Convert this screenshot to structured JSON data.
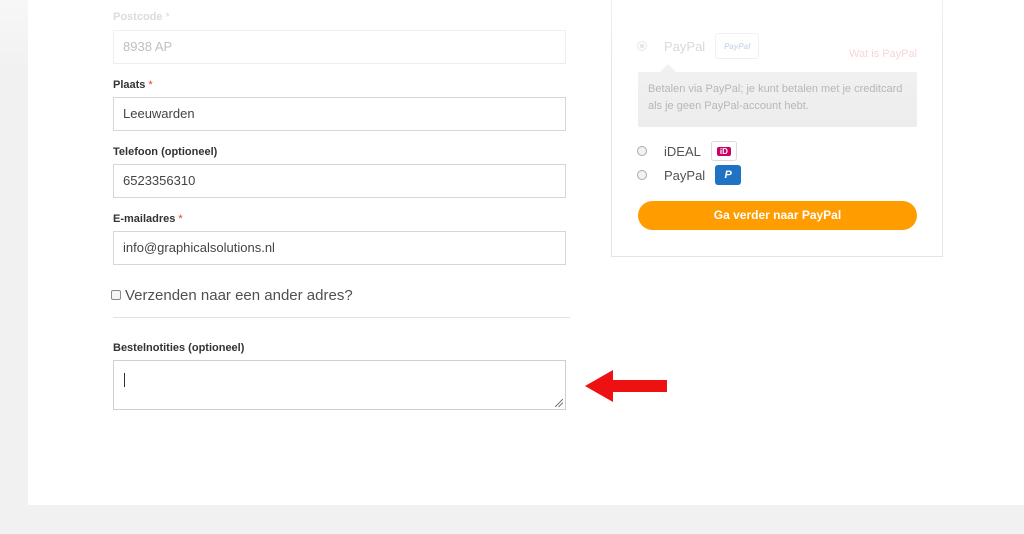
{
  "form": {
    "postcode": {
      "label": "Postcode",
      "required": "*",
      "value": "8938 AP"
    },
    "city": {
      "label": "Plaats",
      "required": "*",
      "value": "Leeuwarden"
    },
    "phone": {
      "label": "Telefoon (optioneel)",
      "value": "6523356310"
    },
    "email": {
      "label": "E-mailadres",
      "required": "*",
      "value": "info@graphicalsolutions.nl"
    },
    "ship_different": {
      "label": "Verzenden naar een ander adres?",
      "checked": false
    },
    "notes": {
      "label": "Bestelnotities (optioneel)",
      "value": ""
    }
  },
  "payment": {
    "top_option": {
      "label": "PayPal",
      "badge": "PayPal",
      "link": "Wat is PayPal"
    },
    "description": "Betalen via PayPal; je kunt betalen met je creditcard als je geen PayPal-account hebt.",
    "options": [
      {
        "label": "iDEAL",
        "badge": "iD",
        "icon": "ideal-icon"
      },
      {
        "label": "PayPal",
        "badge": "P",
        "icon": "paypal-icon"
      }
    ],
    "submit_label": "Ga verder naar PayPal",
    "accent_color": "#ff9d00"
  },
  "annotation": {
    "arrow_color": "#ee1111",
    "icon": "arrow-left-icon"
  }
}
